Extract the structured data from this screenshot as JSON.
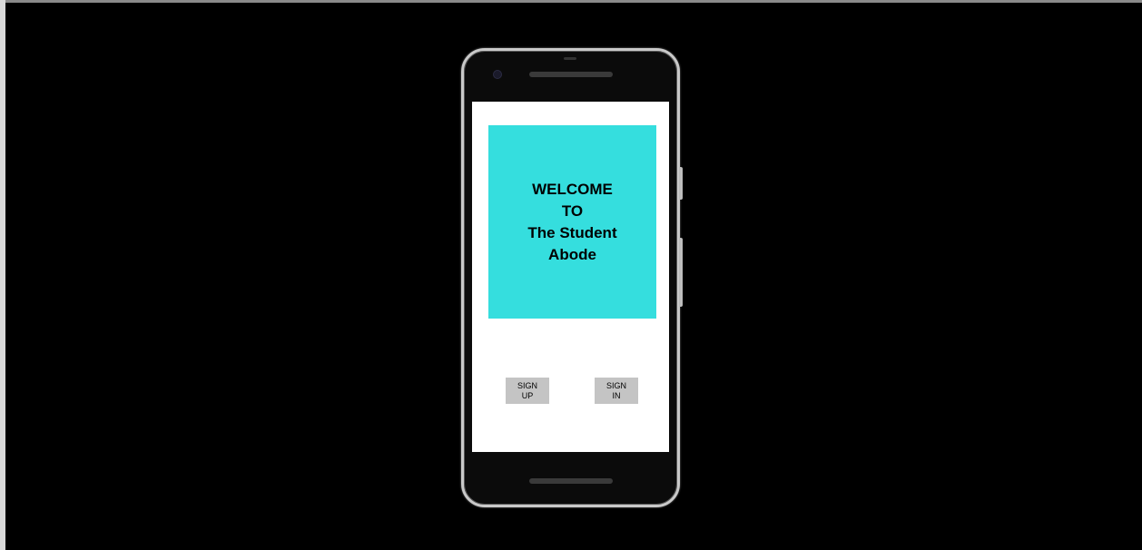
{
  "welcome": {
    "lines": [
      "WELCOME",
      "TO",
      "The Student",
      "Abode"
    ],
    "card_color": "#35dede"
  },
  "buttons": {
    "sign_up": {
      "line1": "SIGN",
      "line2": "UP"
    },
    "sign_in": {
      "line1": "SIGN",
      "line2": "IN"
    }
  },
  "colors": {
    "background": "#000000",
    "screen": "#ffffff",
    "button": "#c4c4c4"
  }
}
